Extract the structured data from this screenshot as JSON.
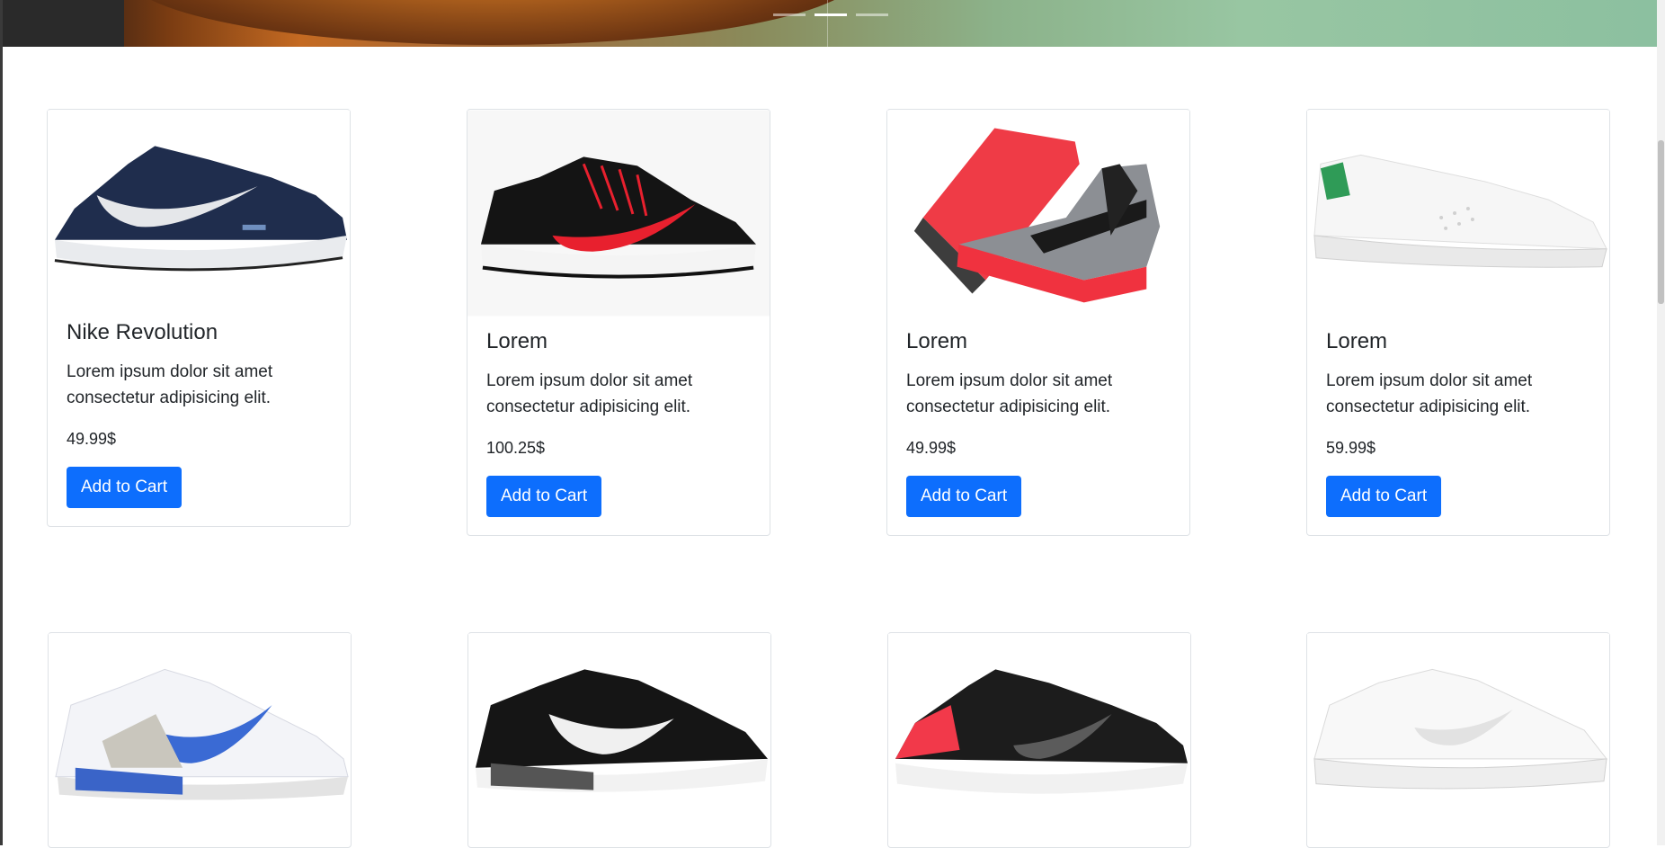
{
  "carousel": {
    "indicators": [
      "Slide 1",
      "Slide 2",
      "Slide 3"
    ],
    "active_index": 1
  },
  "products_row1": [
    {
      "title": "Nike Revolution",
      "description": "Lorem ipsum dolor sit amet consectetur adipisicing elit.",
      "price": "49.99$",
      "button": "Add to Cart",
      "image": "navy-running-shoe"
    },
    {
      "title": "Lorem",
      "description": "Lorem ipsum dolor sit amet consectetur adipisicing elit.",
      "price": "100.25$",
      "button": "Add to Cart",
      "image": "black-red-running-shoe"
    },
    {
      "title": "Lorem",
      "description": "Lorem ipsum dolor sit amet consectetur adipisicing elit.",
      "price": "49.99$",
      "button": "Add to Cart",
      "image": "grey-red-basketball-shoes"
    },
    {
      "title": "Lorem",
      "description": "Lorem ipsum dolor sit amet consectetur adipisicing elit.",
      "price": "59.99$",
      "button": "Add to Cart",
      "image": "white-green-sneaker"
    }
  ],
  "products_row2": [
    {
      "image": "white-blue-air-max"
    },
    {
      "image": "black-air-max"
    },
    {
      "image": "black-red-revolution"
    },
    {
      "image": "white-court-sneaker"
    }
  ],
  "colors": {
    "primary": "#0d6efd",
    "border": "#dee2e6"
  }
}
